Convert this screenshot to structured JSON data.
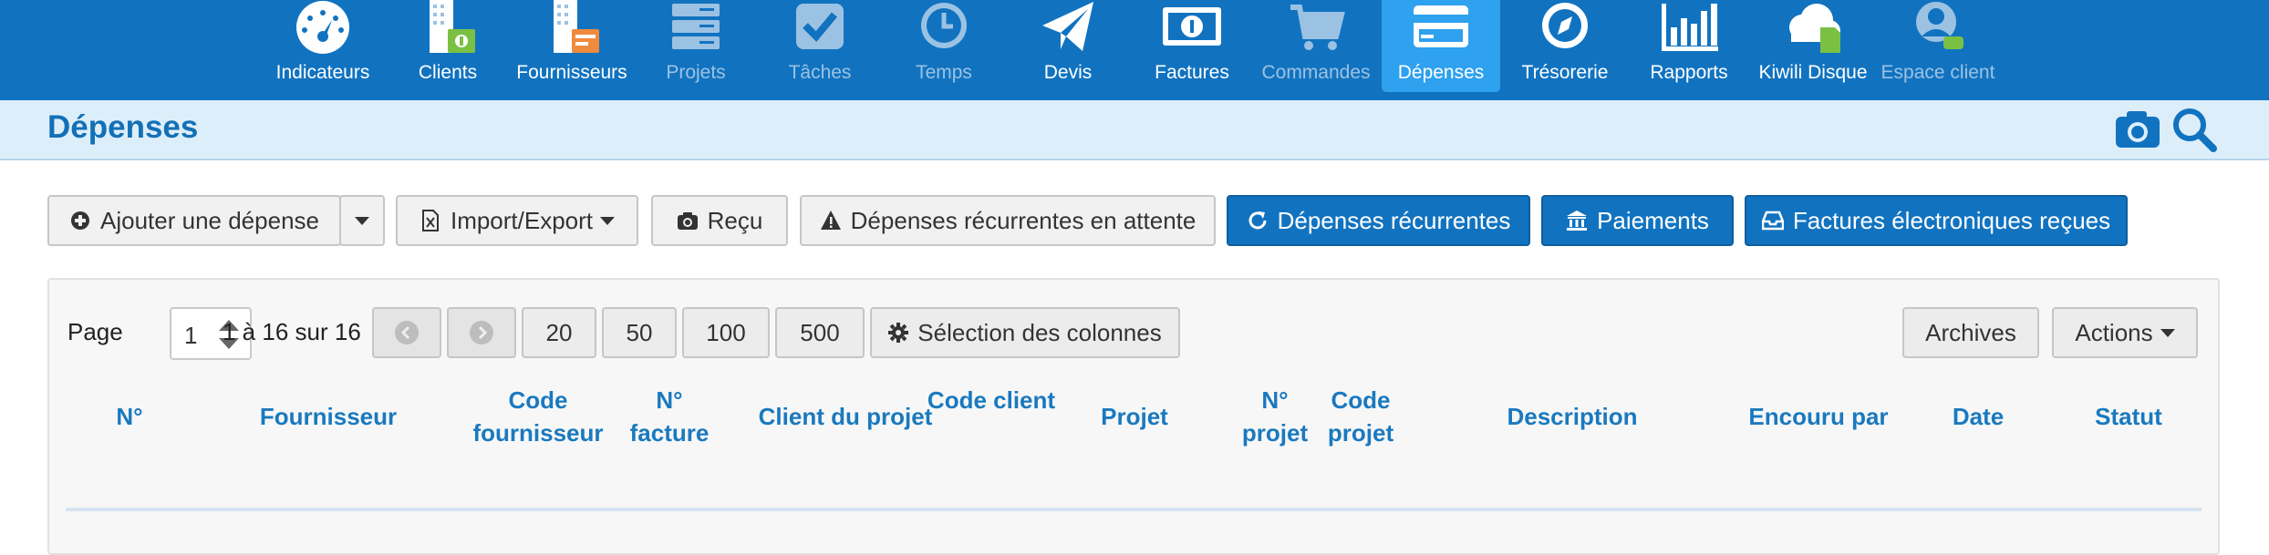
{
  "nav": {
    "items": [
      {
        "label": "Indicateurs",
        "icon": "dashboard-gauge-icon"
      },
      {
        "label": "Clients",
        "icon": "clients-building-icon"
      },
      {
        "label": "Fournisseurs",
        "icon": "suppliers-building-icon"
      },
      {
        "label": "Projets",
        "icon": "projects-stack-icon"
      },
      {
        "label": "Tâches",
        "icon": "tasks-check-icon"
      },
      {
        "label": "Temps",
        "icon": "time-clock-icon"
      },
      {
        "label": "Devis",
        "icon": "quote-paper-plane-icon"
      },
      {
        "label": "Factures",
        "icon": "invoice-banknote-icon"
      },
      {
        "label": "Commandes",
        "icon": "orders-cart-icon"
      },
      {
        "label": "Dépenses",
        "icon": "expenses-card-icon"
      },
      {
        "label": "Trésorerie",
        "icon": "treasury-compass-icon"
      },
      {
        "label": "Rapports",
        "icon": "reports-bar-chart-icon"
      },
      {
        "label": "Kiwili Disque",
        "icon": "drive-cloud-icon"
      },
      {
        "label": "Espace client",
        "icon": "client-space-user-icon"
      }
    ],
    "active": "Dépenses",
    "disabled": [
      "Projets",
      "Tâches",
      "Temps",
      "Commandes",
      "Espace client"
    ]
  },
  "page": {
    "title": "Dépenses",
    "camera_icon": "camera-icon",
    "search_icon": "search-icon"
  },
  "toolbar": {
    "add_expense": "Ajouter une dépense",
    "import_export": "Import/Export",
    "receipt": "Reçu",
    "pending_recurring": "Dépenses récurrentes en attente",
    "recurring": "Dépenses récurrentes",
    "payments": "Paiements",
    "e_invoices": "Factures électroniques reçues"
  },
  "pager": {
    "page_label": "Page",
    "page_value": "1",
    "range_text": "1 à 16 sur 16",
    "sizes": [
      "20",
      "50",
      "100",
      "500"
    ],
    "columns_button": "Sélection des colonnes",
    "archives": "Archives",
    "actions": "Actions"
  },
  "table": {
    "headers": [
      "N°",
      "Fournisseur",
      "Code fournisseur",
      "N° facture",
      "Client du projet",
      "Code client",
      "Projet",
      "N° projet",
      "Code projet",
      "Description",
      "Encouru par",
      "Date",
      "Statut"
    ]
  },
  "colors": {
    "brand": "#1173c0",
    "active_tab": "#2ea1ef",
    "title_bar": "#ddeefb",
    "header_text": "#1a79bf"
  }
}
